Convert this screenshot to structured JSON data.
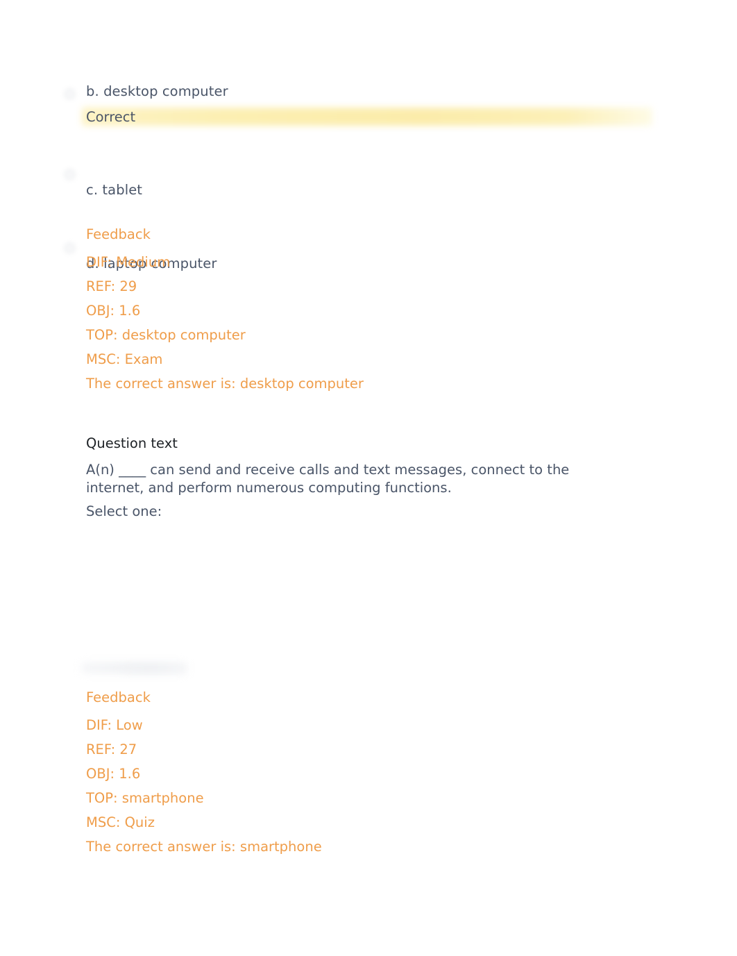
{
  "question1": {
    "options": [
      {
        "id": "b",
        "label": "b. desktop computer",
        "selected": true,
        "result": "Correct"
      },
      {
        "id": "c",
        "label": "c. tablet",
        "selected": false,
        "result": ""
      },
      {
        "id": "d",
        "label": "d. laptop computer",
        "selected": false,
        "result": ""
      }
    ],
    "feedback": {
      "heading": "Feedback",
      "lines": [
        "DIF: Medium",
        "REF: 29",
        "OBJ: 1.6",
        "TOP: desktop computer",
        "MSC: Exam",
        "The correct answer is: desktop computer"
      ]
    }
  },
  "question2": {
    "heading": "Question text",
    "text": "A(n) ____ can send and receive calls and text messages, connect to the internet, and perform numerous computing functions.",
    "select_prompt": "Select one:",
    "feedback": {
      "heading": "Feedback",
      "lines": [
        "DIF: Low",
        "REF: 27",
        "OBJ: 1.6",
        "TOP: smartphone",
        "MSC: Quiz",
        "The correct answer is: smartphone"
      ]
    }
  },
  "colors": {
    "feedback_orange": "#ef9d4a",
    "body_slate": "#4a5568",
    "heading_dark": "#1d2125",
    "correct_highlight": "#fcefb2",
    "page_background": "#ffffff"
  }
}
